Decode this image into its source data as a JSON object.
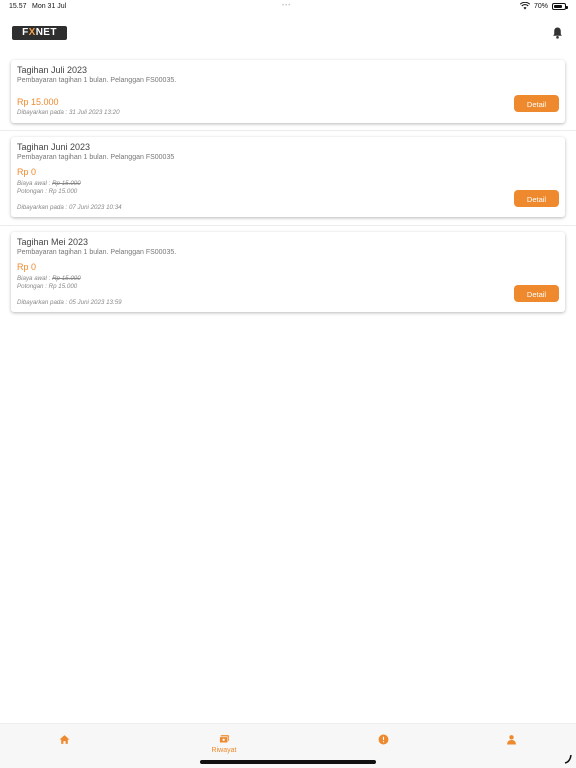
{
  "status_bar": {
    "time": "15.57",
    "date": "Mon 31 Jul",
    "battery": "70%",
    "battery_level": 0.7
  },
  "header": {
    "logo_prefix": "F",
    "logo_mark": "X",
    "logo_suffix": "NET",
    "bell_icon": "bell-icon"
  },
  "bills": [
    {
      "title": "Tagihan Juli 2023",
      "description": "Pembayaran tagihan 1 bulan. Pelanggan FS00035.",
      "amount": "Rp 15.000",
      "paid_at": "Dibayarkan pada : 31 Juli 2023 13:20",
      "button": "Detail"
    },
    {
      "title": "Tagihan Juni 2023",
      "description": "Pembayaran tagihan 1 bulan. Pelanggan FS00035",
      "amount": "Rp 0",
      "original_label": "Biaya awal : ",
      "original_value": "Rp 15.000",
      "discount": "Potongan : Rp 15.000",
      "paid_at": "Dibayarkan pada : 07 Juni 2023 10:34",
      "button": "Detail"
    },
    {
      "title": "Tagihan Mei 2023",
      "description": "Pembayaran tagihan 1 bulan. Pelanggan FS00035.",
      "amount": "Rp 0",
      "original_label": "Biaya awal : ",
      "original_value": "Rp 15.000",
      "discount": "Potongan : Rp 15.000",
      "paid_at": "Dibayarkan pada : 05 Juni 2023 13:59",
      "button": "Detail"
    }
  ],
  "bottom_nav": {
    "active": "Riwayat",
    "items": [
      {
        "icon": "home-icon",
        "label": ""
      },
      {
        "icon": "history-icon",
        "label": "Riwayat"
      },
      {
        "icon": "info-icon",
        "label": ""
      },
      {
        "icon": "profile-icon",
        "label": ""
      }
    ]
  },
  "colors": {
    "accent": "#ee8a2d",
    "logo_bg": "#2e2e2e"
  }
}
